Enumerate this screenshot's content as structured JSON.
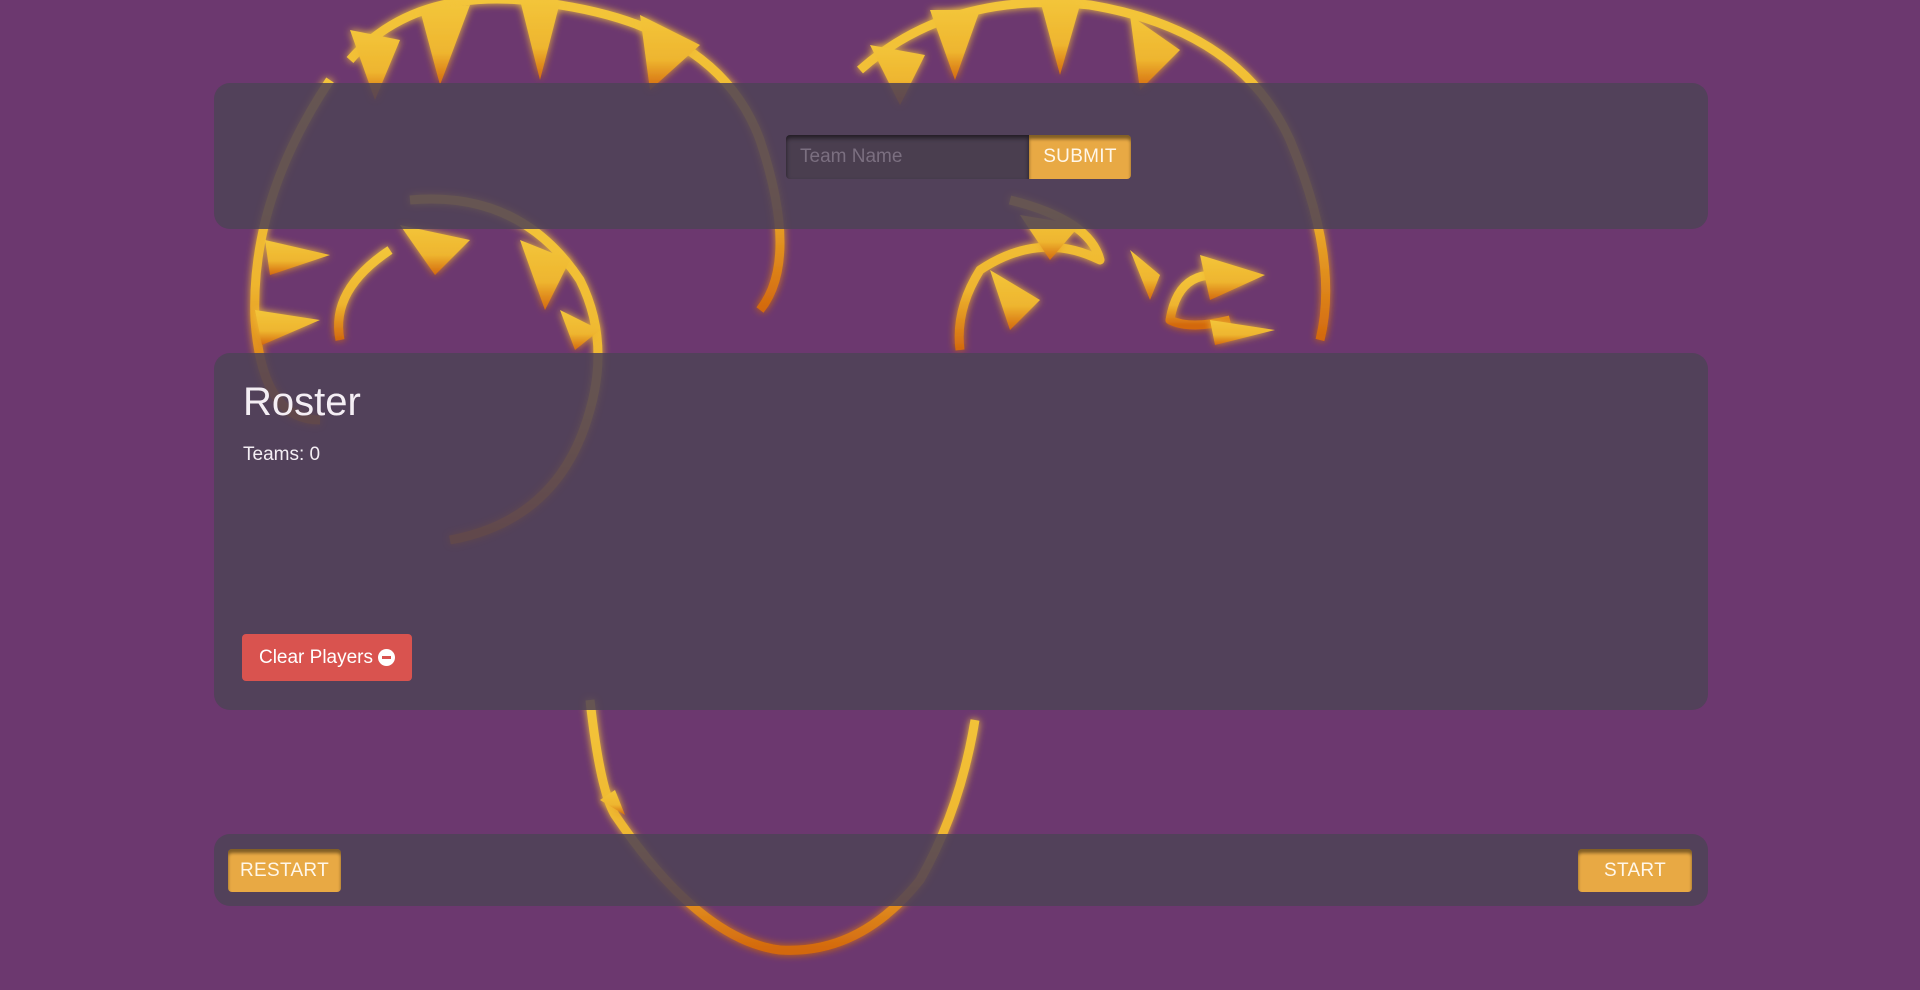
{
  "form": {
    "input_placeholder": "Team Name",
    "input_value": "",
    "submit_label": "SUBMIT"
  },
  "roster": {
    "title": "Roster",
    "teams_count_text": "Teams: 0",
    "clear_label": "Clear Players",
    "clear_icon": "minus-circle-icon"
  },
  "footer": {
    "restart_label": "RESTART",
    "start_label": "START"
  },
  "colors": {
    "background": "#6c386f",
    "panel": "#4e4256",
    "accent_gold": "#e8a944",
    "danger": "#d9534f",
    "art_yellow": "#f0c63a",
    "art_orange": "#d9730f"
  }
}
